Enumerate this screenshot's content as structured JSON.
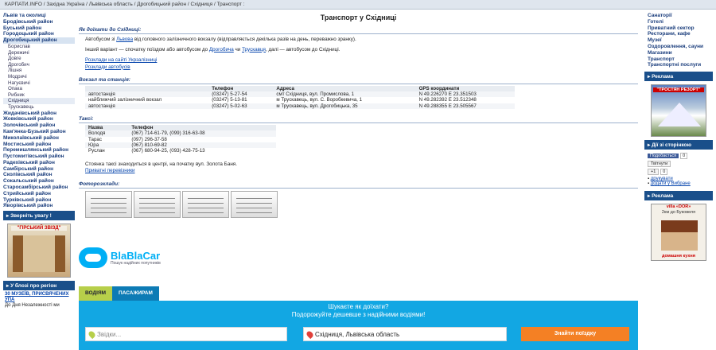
{
  "breadcrumb": {
    "text": "КАРПАТИ.INFO / Західна Україна / Львівська область / Дрогобицький район / Східниця / Транспорт :"
  },
  "left": {
    "items": [
      {
        "label": "Львів та околиці",
        "type": "item"
      },
      {
        "label": "Бродівський район",
        "type": "item"
      },
      {
        "label": "Буський район",
        "type": "item"
      },
      {
        "label": "Городоцький район",
        "type": "item"
      },
      {
        "label": "Дрогобицький район",
        "type": "item-sel"
      },
      {
        "label": "Борислав",
        "type": "sub"
      },
      {
        "label": "Дережичі",
        "type": "sub"
      },
      {
        "label": "Довге",
        "type": "sub"
      },
      {
        "label": "Дрогобич",
        "type": "sub"
      },
      {
        "label": "Лішня",
        "type": "sub"
      },
      {
        "label": "Модричі",
        "type": "sub"
      },
      {
        "label": "Нагуєвичі",
        "type": "sub"
      },
      {
        "label": "Опака",
        "type": "sub"
      },
      {
        "label": "Рибник",
        "type": "sub"
      },
      {
        "label": "Східниця",
        "type": "sub-cur"
      },
      {
        "label": "Трускавець",
        "type": "sub"
      },
      {
        "label": "Жидачівський район",
        "type": "item"
      },
      {
        "label": "Жовківський район",
        "type": "item"
      },
      {
        "label": "Золочівський район",
        "type": "item"
      },
      {
        "label": "Кам'янка-Бузький район",
        "type": "item"
      },
      {
        "label": "Миколаївський район",
        "type": "item"
      },
      {
        "label": "Мостиський район",
        "type": "item"
      },
      {
        "label": "Перемишлянський район",
        "type": "item"
      },
      {
        "label": "Пустомитівський район",
        "type": "item"
      },
      {
        "label": "Радехівський район",
        "type": "item"
      },
      {
        "label": "Самбірський район",
        "type": "item"
      },
      {
        "label": "Сколівський район",
        "type": "item"
      },
      {
        "label": "Сокальський район",
        "type": "item"
      },
      {
        "label": "Старосамбірський район",
        "type": "item"
      },
      {
        "label": "Стрийський район",
        "type": "item"
      },
      {
        "label": "Турківський район",
        "type": "item"
      },
      {
        "label": "Яворівський район",
        "type": "item"
      }
    ],
    "attention_head": "▸ Зверніть увагу !",
    "attention_ad": "\"ГІРСЬКИЙ ЗВІЗД\"",
    "museum_head": "▸ У блозі про регіон",
    "museum_link": "30 МУЗЕЇВ, ПРИСВЯЧЕНИХ УПА",
    "museum_sub": "До Дня Незалежності ми"
  },
  "main": {
    "title": "Транспорт у Східниці",
    "sec_how": "Як доїхати до Східниці:",
    "how_p1_a": "Автобусом зі ",
    "how_p1_link": "Львова",
    "how_p1_b": " від головного залізничного вокзалу (відправляється декілька разів на день, переважно зранку).",
    "how_p2_a": "Інший варіант — спочатку поїздом або автобусом до ",
    "how_p2_link1": "Дрогобича",
    "how_p2_mid": " чи ",
    "how_p2_link2": "Трускавця",
    "how_p2_b": ", далі — автобусом до Східниці.",
    "link_uz": "Розклади на сайті Укрзалізниці",
    "link_bus": "Розклади автобусів",
    "sec_station": "Вокзал та станція:",
    "station_headers": [
      "",
      "Телефон",
      "Адреса",
      "GPS координати"
    ],
    "stations": [
      [
        "автостанція",
        "(03247) 5-27-54",
        "смт Східниця, вул. Промислова, 1",
        "N 49.226270 E 23.351503"
      ],
      [
        "найближчий залізничний вокзал",
        "(03247) 5-13-81",
        "м Трускавець, вул. С. Воробкевича, 1",
        "N 49.282392 E 23.512348"
      ],
      [
        "автостанція",
        "(03247) 5-02-63",
        "м Трускавець, вул. Дрогобицька, 35",
        "N 49.288355 E 23.505567"
      ]
    ],
    "sec_taxi": "Таксі:",
    "taxi_headers": [
      "Назва",
      "Телефон"
    ],
    "taxis": [
      [
        "Володя",
        "(067) 714-61-79, (099) 316-63-08"
      ],
      [
        "Тарас",
        "(097) 296-37-58"
      ],
      [
        "Юра",
        "(067) 810-69-82"
      ],
      [
        "Руслан",
        "(067) 680-94-25, (093) 428-75-13"
      ]
    ],
    "taxi_note": "Стоянка таксі знаходиться в центрі, на початку вул. Золота Баня.",
    "taxi_link": "Приватні перевізники",
    "sec_photo": "Фоторозклади:",
    "blablacar": {
      "logo": "BlaBlaCar",
      "slogan": "Пошук надійних попутників",
      "tab_driver": "ВОДІЯМ",
      "tab_passenger": "ПАСАЖИРАМ",
      "q1": "Шукаєте як доїхати?",
      "q2": "Подорожуйте дешевше з надійними водіями!",
      "from_placeholder": "Звідки...",
      "to_value": "Східниця, Львівська область",
      "find_button": "Знайти поїздку"
    }
  },
  "right": {
    "items": [
      "Санаторії",
      "Готелі",
      "Приватний сектор",
      "Ресторани, кафе",
      "Музеї",
      "Оздоровлення, сауни",
      "Магазини",
      "Транспорт",
      "Транспортні послуги"
    ],
    "ads_head": "▸ Реклама",
    "ad1_title": "\"ТРОСТЯН РЕЗОРТ\"",
    "share_head": "▸ Дії зі сторінкою",
    "share_fb": "Подобається",
    "share_count": "0",
    "share_tw": "Твітнути",
    "share_gplus": "+1",
    "print": "друкувати",
    "favorite": "додати у Вибране",
    "ads_head2": "▸ Реклама",
    "ad2_title": "villa «DOR»",
    "ad2_sub": "2км до Буковеля",
    "ad2_foot": "домашня кухня"
  },
  "colors": {
    "accent": "#1a4f8a",
    "blablacar_blue": "#12a7e3",
    "cta_orange": "#f48024"
  }
}
